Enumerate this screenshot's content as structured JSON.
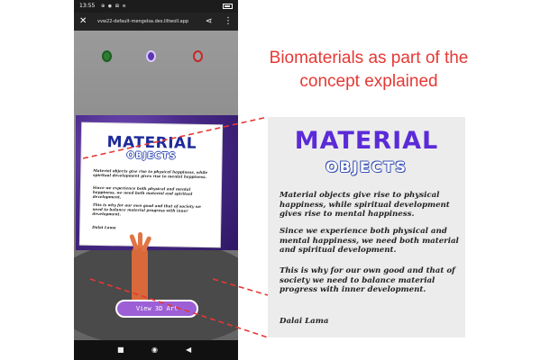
{
  "status_bar": {
    "time": "13:55",
    "icons": "⊕ ◉ ⊞ ≋",
    "right_icons": "≈ ▮"
  },
  "browser": {
    "url": "vvw22-default-mengelsa.des.liltwoll.app",
    "close_icon": "close-icon",
    "share_icon": "share-icon",
    "more_icon": "more-icon"
  },
  "poster": {
    "title": "MATERIAL",
    "subtitle": "OBJECTS",
    "paragraphs": [
      "Material objects give rise to physical happiness, while spiritual development gives rise to mental happiness.",
      "Since we experience both physical and mental happiness, we need both material and spiritual development.",
      "This is why for our own good and that of society we need to balance material progress with inner development."
    ],
    "author": "Dalai Lama"
  },
  "view_button": {
    "label": "View 3D Art"
  },
  "nav": {
    "square": "■",
    "circle": "◉",
    "back": "◀"
  },
  "annotation": {
    "heading": "Biomaterials as part of the concept explained",
    "line_color": "#e53935",
    "heading_color": "#e53935"
  },
  "colors": {
    "title_purple": "#5b2bd8",
    "outline_blue": "#3b52b4",
    "button_purple": "#9c5fd6"
  }
}
